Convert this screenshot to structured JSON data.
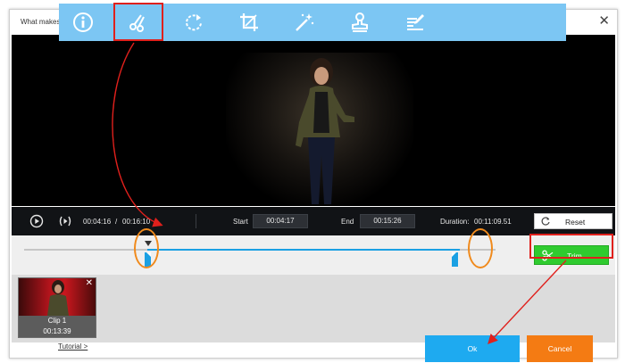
{
  "window": {
    "title": "What makes",
    "close_glyph": "✕"
  },
  "toolbar": {
    "tools": [
      {
        "icon": "info-icon"
      },
      {
        "icon": "scissors-icon",
        "selected": true
      },
      {
        "icon": "rotate-icon"
      },
      {
        "icon": "crop-icon"
      },
      {
        "icon": "magic-wand-icon"
      },
      {
        "icon": "stamp-icon"
      },
      {
        "icon": "edit-text-icon"
      }
    ]
  },
  "playback": {
    "current_time": "00:04:16",
    "separator": "/",
    "total_time": "00:16:10",
    "start_label": "Start",
    "start_value": "00:04:17",
    "end_label": "End",
    "end_value": "00:15:26",
    "duration_label": "Duration:",
    "duration_value": "00:11:09.51",
    "reset_label": "Reset"
  },
  "timeline": {
    "start_fraction": 0.262,
    "end_fraction": 0.955
  },
  "trim": {
    "label": "Trim"
  },
  "clips": [
    {
      "name": "Clip 1",
      "duration": "00:13:39",
      "close_glyph": "✕"
    }
  ],
  "footer": {
    "tutorial_link": "Tutorial >",
    "ok_label": "Ok",
    "cancel_label": "Cancel"
  },
  "colors": {
    "toolbar_bg": "#7cc6f3",
    "highlight_red": "#e0201c",
    "highlight_orange": "#f08a1c",
    "trim_green": "#2fcb2f",
    "ok_blue": "#1eaaf0",
    "cancel_orange": "#f47b13",
    "track_blue": "#1aa0e3"
  }
}
